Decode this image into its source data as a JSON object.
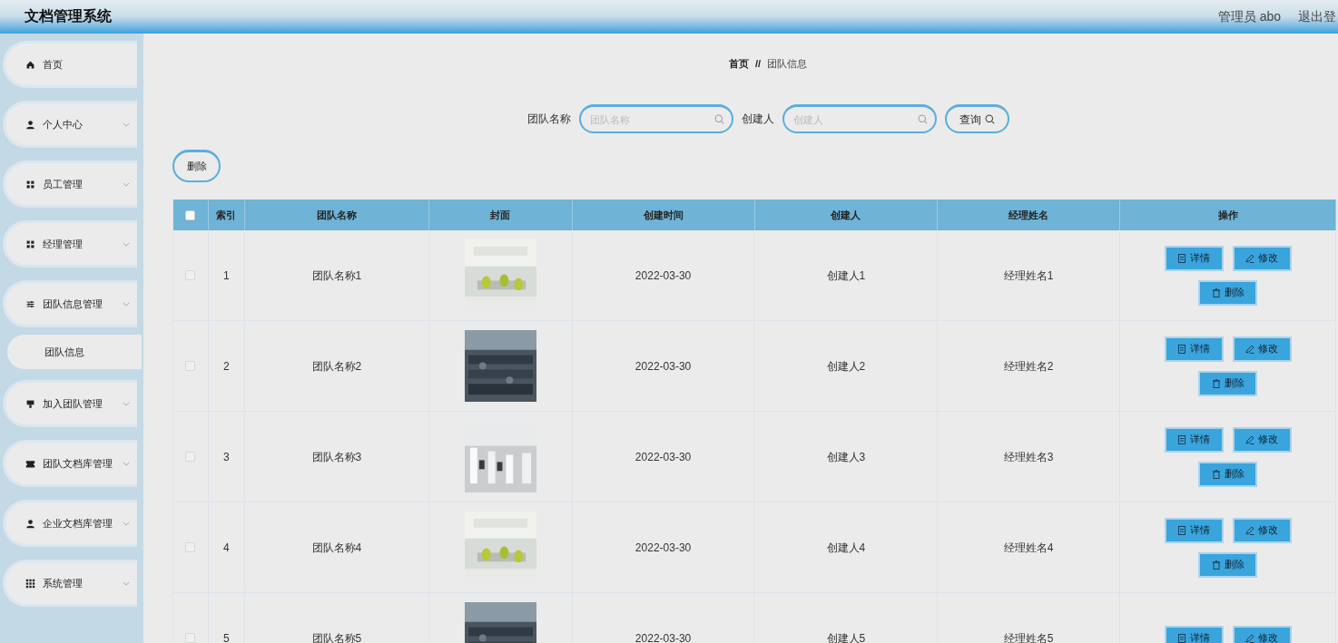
{
  "header": {
    "title": "文档管理系统",
    "user": "管理员 abo",
    "logout": "退出登"
  },
  "sidebar": {
    "items": [
      {
        "label": "首页",
        "expandable": false
      },
      {
        "label": "个人中心",
        "expandable": true
      },
      {
        "label": "员工管理",
        "expandable": true
      },
      {
        "label": "经理管理",
        "expandable": true
      },
      {
        "label": "团队信息管理",
        "expandable": true,
        "children": [
          {
            "label": "团队信息"
          }
        ]
      },
      {
        "label": "加入团队管理",
        "expandable": true
      },
      {
        "label": "团队文档库管理",
        "expandable": true
      },
      {
        "label": "企业文档库管理",
        "expandable": true
      },
      {
        "label": "系统管理",
        "expandable": true
      }
    ]
  },
  "breadcrumb": [
    "首页",
    "团队信息"
  ],
  "breadcrumb_separator": "//",
  "search": {
    "fields": [
      {
        "label": "团队名称",
        "placeholder": "团队名称"
      },
      {
        "label": "创建人",
        "placeholder": "创建人"
      }
    ],
    "button": "查询"
  },
  "delete_button": "删除",
  "table": {
    "columns": [
      "索引",
      "团队名称",
      "封面",
      "创建时间",
      "创建人",
      "经理姓名",
      "操作"
    ],
    "header_checked": false,
    "rows": [
      {
        "index": "1",
        "name": "团队名称1",
        "cover": {
          "kind": "picture"
        },
        "created": "2022-03-30",
        "creator": "创建人1",
        "manager": "经理姓名1",
        "checked": false,
        "actions": [
          "详情",
          "修改",
          "删除"
        ]
      },
      {
        "index": "2",
        "name": "团队名称2",
        "cover": {
          "kind": "picture"
        },
        "created": "2022-03-30",
        "creator": "创建人2",
        "manager": "经理姓名2",
        "checked": false,
        "actions": [
          "详情",
          "修改",
          "删除"
        ]
      },
      {
        "index": "3",
        "name": "团队名称3",
        "cover": {
          "kind": "picture"
        },
        "created": "2022-03-30",
        "creator": "创建人3",
        "manager": "经理姓名3",
        "checked": false,
        "actions": [
          "详情",
          "修改",
          "删除"
        ]
      },
      {
        "index": "4",
        "name": "团队名称4",
        "cover": {
          "kind": "picture"
        },
        "created": "2022-03-30",
        "creator": "创建人4",
        "manager": "经理姓名4",
        "checked": false,
        "actions": [
          "详情",
          "修改",
          "删除"
        ]
      },
      {
        "index": "5",
        "name": "团队名称5",
        "cover": {
          "kind": "picture"
        },
        "created": "2022-03-30",
        "creator": "创建人5",
        "manager": "经理姓名5",
        "checked": false,
        "actions": [
          "详情",
          "修改"
        ]
      }
    ]
  }
}
